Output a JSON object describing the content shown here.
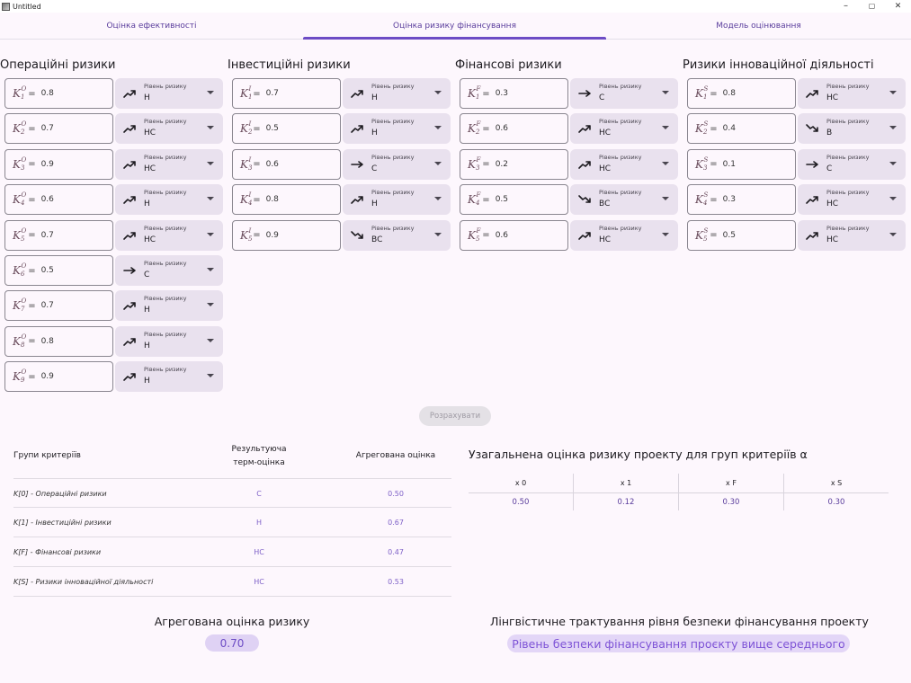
{
  "window": {
    "title": "Untitled",
    "minimize": "–",
    "maximize": "▢",
    "close": "✕"
  },
  "tabs": [
    {
      "label": "Оцінка ефективності",
      "selected": false
    },
    {
      "label": "Оцінка ризику фінансування",
      "selected": true
    },
    {
      "label": "Модель оцінювання",
      "selected": false
    }
  ],
  "dropdown_label": "Рівень ризику",
  "groups": [
    {
      "title": "Операційні ризики",
      "sup": "O",
      "rows": [
        {
          "sub": "1",
          "value": "0.8",
          "level": "Н",
          "trend": "up"
        },
        {
          "sub": "2",
          "value": "0.7",
          "level": "НС",
          "trend": "up"
        },
        {
          "sub": "3",
          "value": "0.9",
          "level": "НС",
          "trend": "up"
        },
        {
          "sub": "4",
          "value": "0.6",
          "level": "Н",
          "trend": "up"
        },
        {
          "sub": "5",
          "value": "0.7",
          "level": "НС",
          "trend": "up"
        },
        {
          "sub": "6",
          "value": "0.5",
          "level": "С",
          "trend": "flat"
        },
        {
          "sub": "7",
          "value": "0.7",
          "level": "Н",
          "trend": "up"
        },
        {
          "sub": "8",
          "value": "0.8",
          "level": "Н",
          "trend": "up"
        },
        {
          "sub": "9",
          "value": "0.9",
          "level": "Н",
          "trend": "up"
        }
      ]
    },
    {
      "title": "Інвестиційні ризики",
      "sup": "I",
      "rows": [
        {
          "sub": "1",
          "value": "0.7",
          "level": "Н",
          "trend": "up"
        },
        {
          "sub": "2",
          "value": "0.5",
          "level": "Н",
          "trend": "up"
        },
        {
          "sub": "3",
          "value": "0.6",
          "level": "С",
          "trend": "flat"
        },
        {
          "sub": "4",
          "value": "0.8",
          "level": "Н",
          "trend": "up"
        },
        {
          "sub": "5",
          "value": "0.9",
          "level": "ВС",
          "trend": "down"
        }
      ]
    },
    {
      "title": "Фінансові ризики",
      "sup": "F",
      "rows": [
        {
          "sub": "1",
          "value": "0.3",
          "level": "С",
          "trend": "flat"
        },
        {
          "sub": "2",
          "value": "0.6",
          "level": "НС",
          "trend": "up"
        },
        {
          "sub": "3",
          "value": "0.2",
          "level": "НС",
          "trend": "up"
        },
        {
          "sub": "4",
          "value": "0.5",
          "level": "ВС",
          "trend": "down"
        },
        {
          "sub": "5",
          "value": "0.6",
          "level": "НС",
          "trend": "up"
        }
      ]
    },
    {
      "title": "Ризики інноваційної діяльності",
      "sup": "S",
      "rows": [
        {
          "sub": "1",
          "value": "0.8",
          "level": "НС",
          "trend": "up"
        },
        {
          "sub": "2",
          "value": "0.4",
          "level": "В",
          "trend": "down"
        },
        {
          "sub": "3",
          "value": "0.1",
          "level": "С",
          "trend": "flat"
        },
        {
          "sub": "4",
          "value": "0.3",
          "level": "НС",
          "trend": "up"
        },
        {
          "sub": "5",
          "value": "0.5",
          "level": "НС",
          "trend": "up"
        }
      ]
    }
  ],
  "calculate_button": "Розрахувати",
  "results_table": {
    "headers": [
      "Групи критеріїв",
      "Результуюча терм-оцінка",
      "Агрегована оцінка"
    ],
    "rows": [
      {
        "group": "K[0] - Операційні ризики",
        "term": "С",
        "agg": "0.50"
      },
      {
        "group": "K[1] - Інвестиційні ризики",
        "term": "Н",
        "agg": "0.67"
      },
      {
        "group": "K[F] - Фінансові ризики",
        "term": "НС",
        "agg": "0.47"
      },
      {
        "group": "K[S] - Ризики інноваційної діяльності",
        "term": "НС",
        "agg": "0.53"
      }
    ]
  },
  "alpha": {
    "title": "Узагальнена оцінка ризику проекту для груп критеріїв α",
    "columns": [
      {
        "header": "x 0",
        "value": "0.50"
      },
      {
        "header": "x 1",
        "value": "0.12"
      },
      {
        "header": "x F",
        "value": "0.30"
      },
      {
        "header": "x S",
        "value": "0.30"
      }
    ]
  },
  "aggregate": {
    "title": "Агрегована оцінка ризику",
    "value": "0.70"
  },
  "linguistic": {
    "title": "Лінгвістичне трактування рівня безпеки фінансування проекту",
    "value": "Рівень безпеки фінансування проєкту вище середнього"
  }
}
